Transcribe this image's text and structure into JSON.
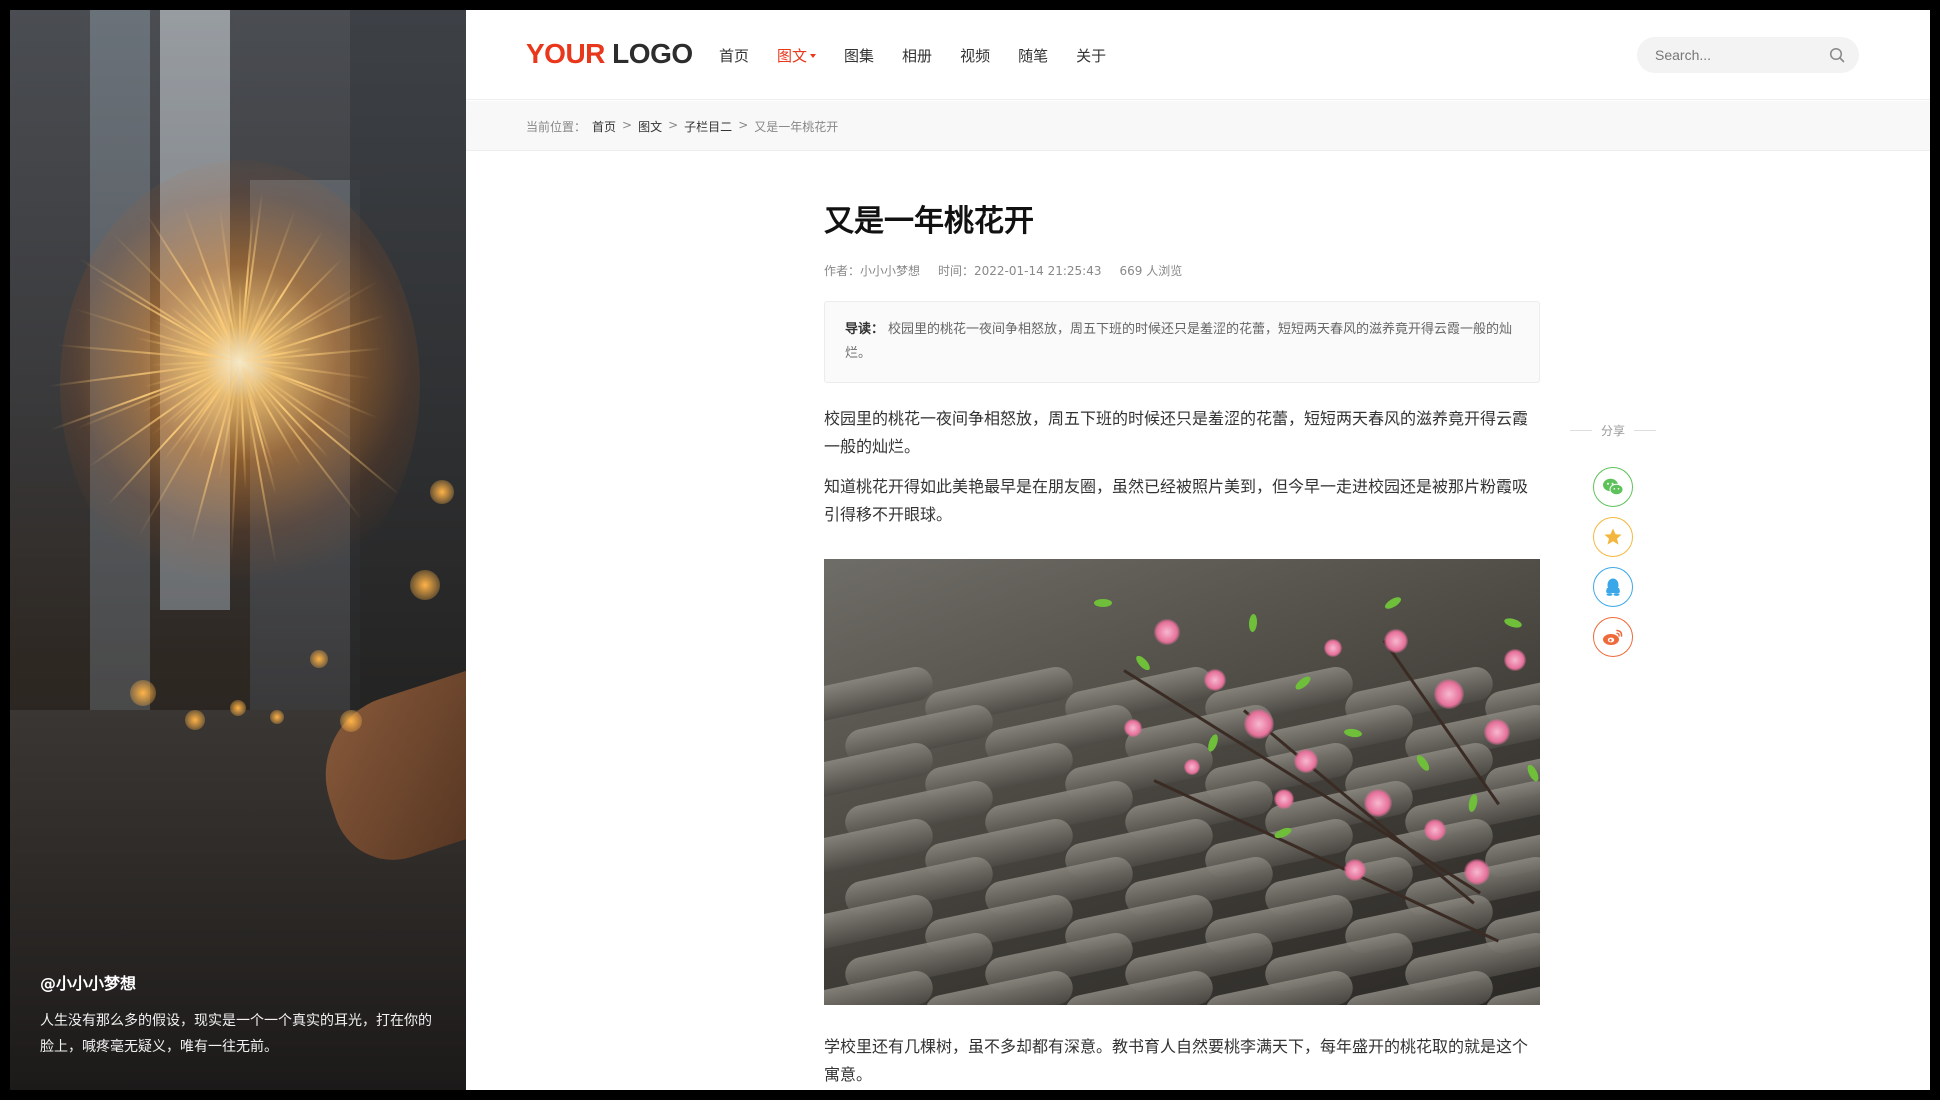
{
  "header": {
    "logo_part1": "YOUR",
    "logo_part2": " LOGO",
    "nav": [
      "首页",
      "图文",
      "图集",
      "相册",
      "视频",
      "随笔",
      "关于"
    ],
    "search_placeholder": "Search..."
  },
  "breadcrumb": {
    "prefix": "当前位置：",
    "items": [
      "首页",
      "图文",
      "子栏目二",
      "又是一年桃花开"
    ],
    "separator": ">"
  },
  "hero": {
    "author": "@小小小梦想",
    "quote": "人生没有那么多的假设，现实是一个一个真实的耳光，打在你的脸上，喊疼毫无疑义，唯有一往无前。"
  },
  "article": {
    "title": "又是一年桃花开",
    "author": "作者：小小小梦想",
    "time": "时间：2022-01-14 21:25:43",
    "views": "669 人浏览",
    "lead_label": "导读：",
    "lead_text": "校园里的桃花一夜间争相怒放，周五下班的时候还只是羞涩的花蕾，短短两天春风的滋养竟开得云霞一般的灿烂。",
    "paragraphs": [
      "校园里的桃花一夜间争相怒放，周五下班的时候还只是羞涩的花蕾，短短两天春风的滋养竟开得云霞一般的灿烂。",
      "知道桃花开得如此美艳最早是在朋友圈，虽然已经被照片美到，但今早一走进校园还是被那片粉霞吸引得移不开眼球。"
    ],
    "tail": "学校里还有几棵树，虽不多却都有深意。教书育人自然要桃李满天下，每年盛开的桃花取的就是这个寓意。"
  },
  "share": {
    "label": "分享",
    "wechat_color": "#5ec25a",
    "favorite_color": "#f4b73e",
    "qq_color": "#3aa8e8",
    "weibo_color": "#ef6a3a"
  },
  "colors": {
    "accent": "#e8371b"
  }
}
